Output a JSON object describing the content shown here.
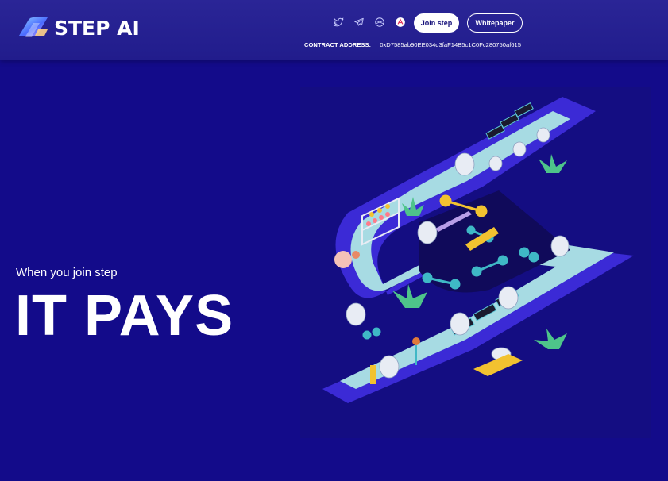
{
  "header": {
    "brand": "STEP AI",
    "socials": [
      {
        "name": "twitter-icon"
      },
      {
        "name": "telegram-icon"
      },
      {
        "name": "globe-icon"
      },
      {
        "name": "dapp-icon"
      }
    ],
    "join_label": "Join step",
    "whitepaper_label": "Whitepaper",
    "contract_label": "CONTRACT ADDRESS:",
    "contract_address": "0xD7585ab90EE034d3faF14B5c1C0Fc280750af615"
  },
  "hero": {
    "tagline": "When you join step",
    "headline": "IT PAYS"
  },
  "colors": {
    "background": "#130b8a",
    "header": "#2a2596",
    "path": "#a7dbe3",
    "wall": "#3b2ad6"
  }
}
